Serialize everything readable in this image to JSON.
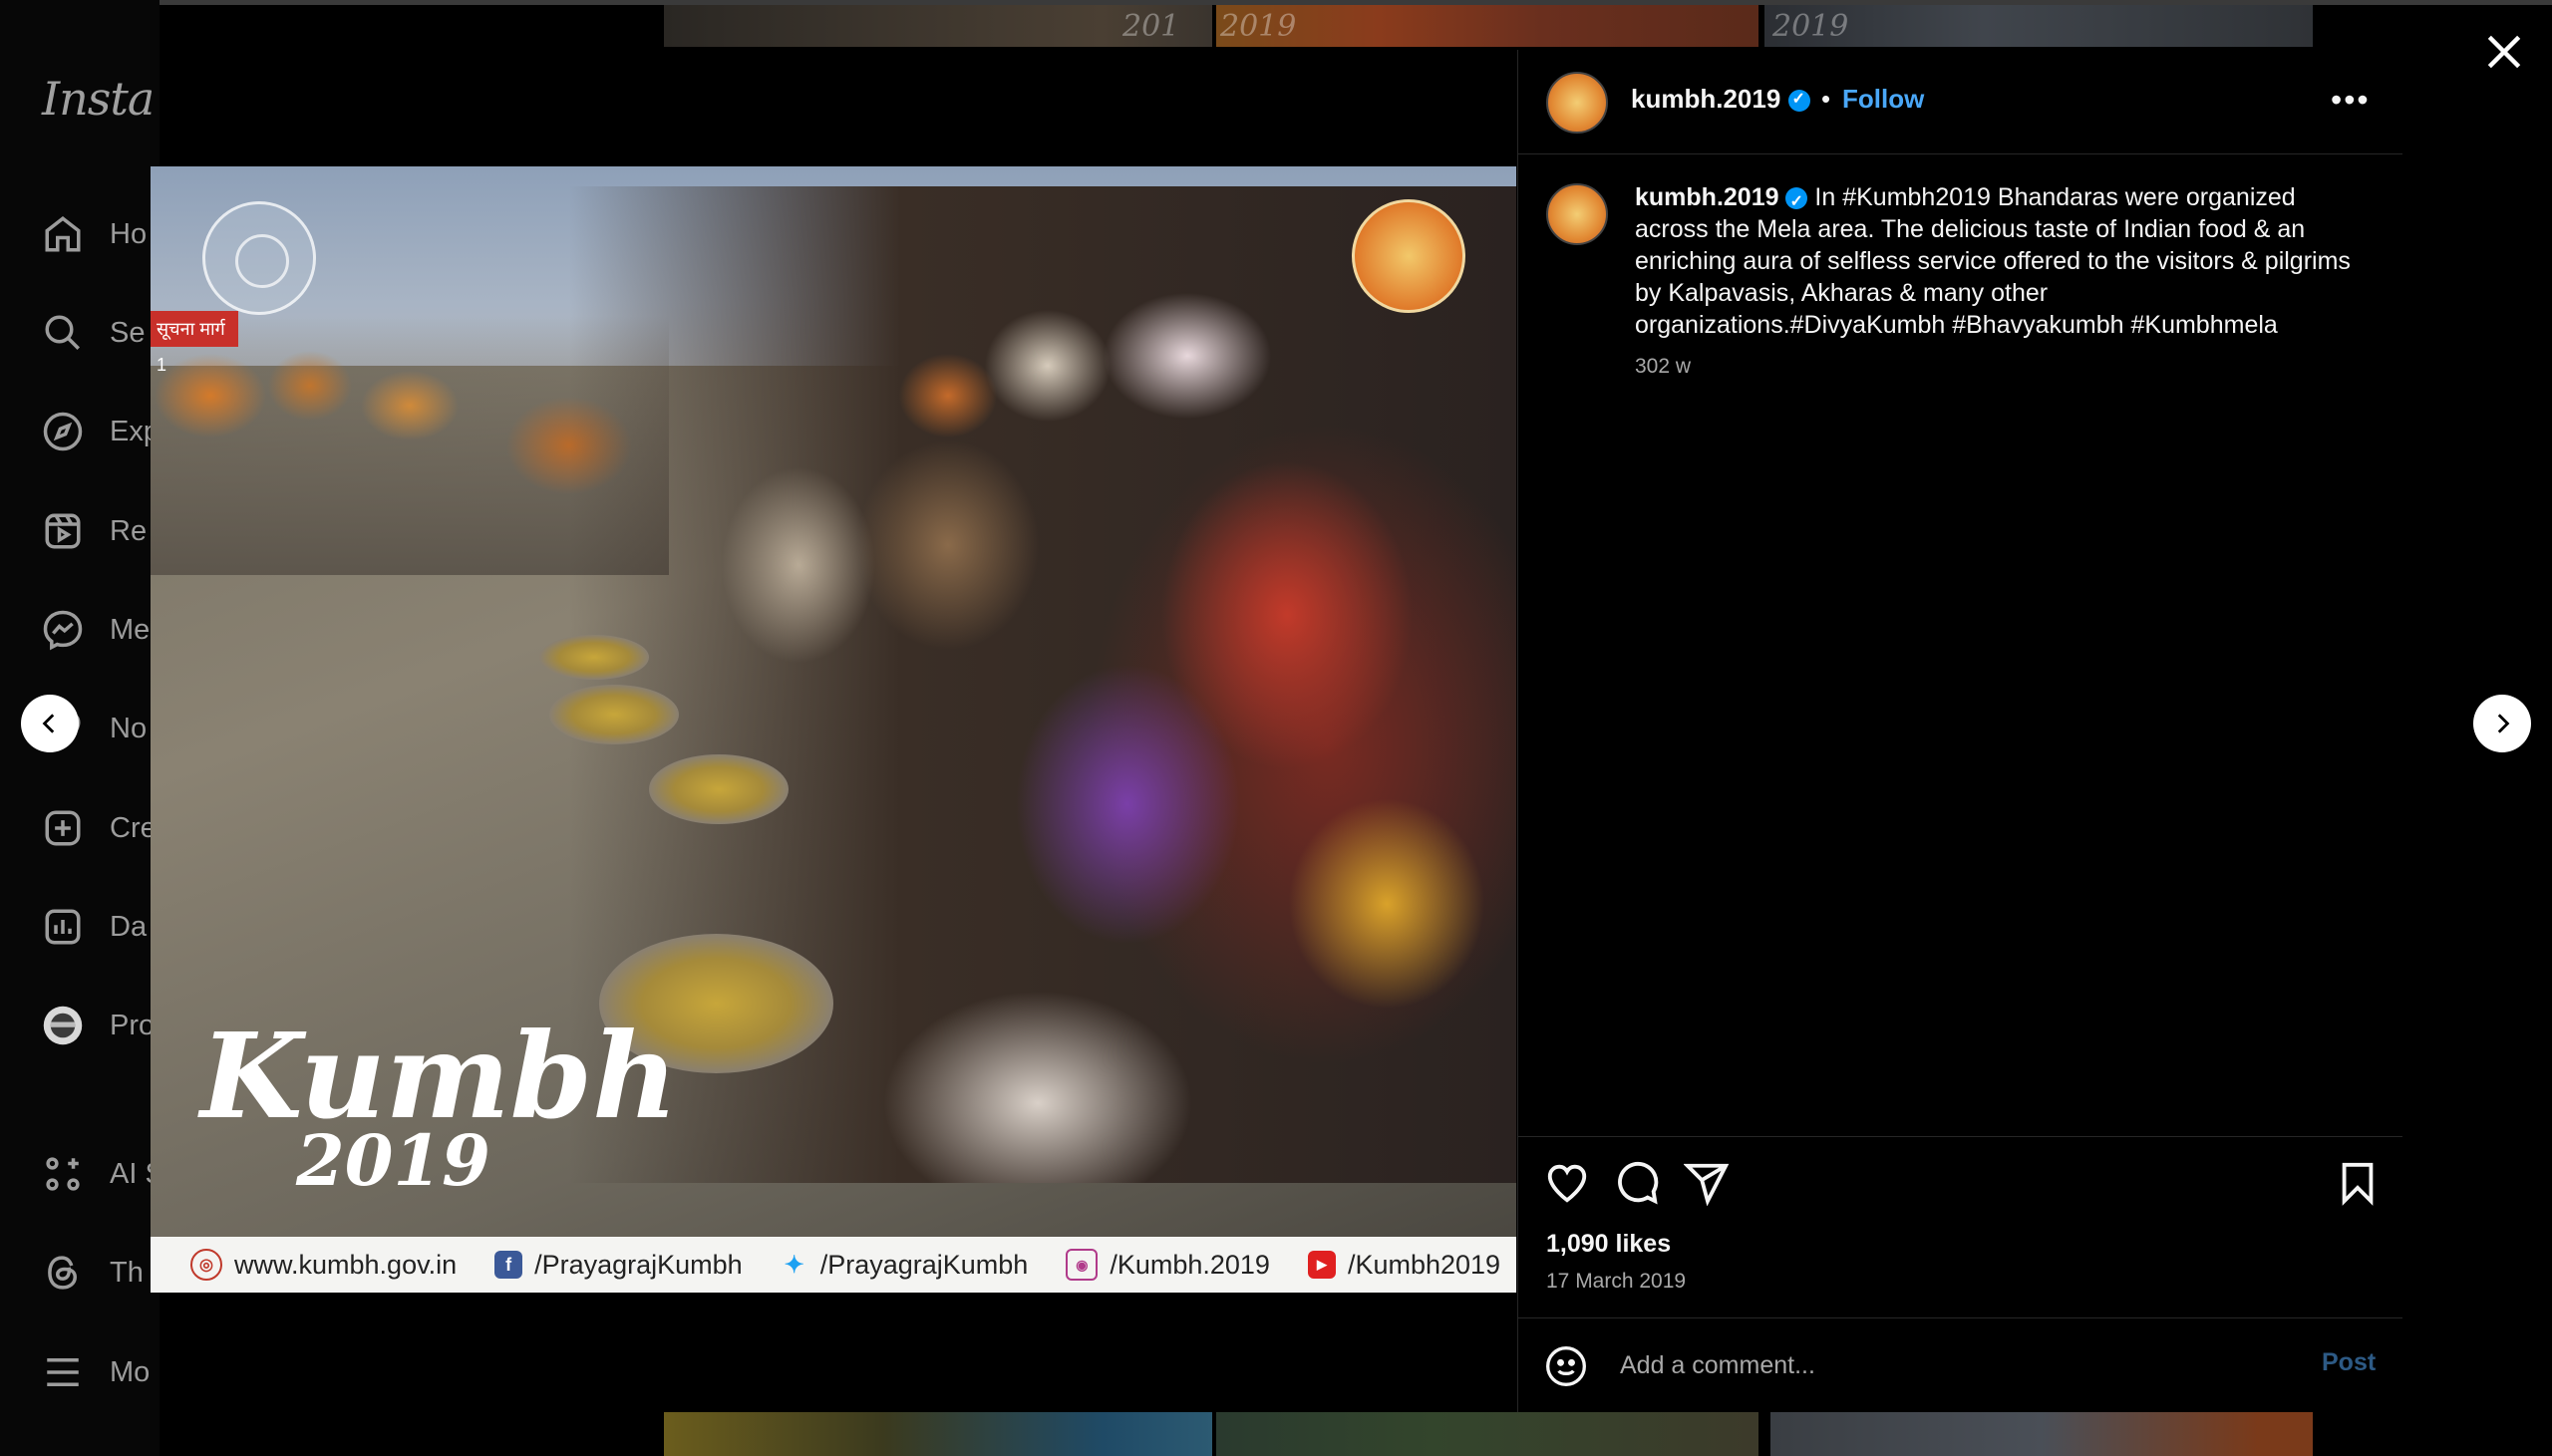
{
  "sidebar": {
    "logo": "Instag",
    "items": [
      {
        "label": "Ho",
        "icon": "home-icon"
      },
      {
        "label": "Se",
        "icon": "search-icon"
      },
      {
        "label": "Exp",
        "icon": "explore-icon"
      },
      {
        "label": "Re",
        "icon": "reels-icon"
      },
      {
        "label": "Me",
        "icon": "messenger-icon"
      },
      {
        "label": "No",
        "icon": "heart-icon"
      },
      {
        "label": "Cre",
        "icon": "create-icon"
      },
      {
        "label": "Da",
        "icon": "dashboard-icon"
      },
      {
        "label": "Pro",
        "icon": "profile-icon"
      },
      {
        "label": "AI S",
        "icon": "ai-studio-icon"
      },
      {
        "label": "Th",
        "icon": "threads-icon"
      },
      {
        "label": "Mo",
        "icon": "menu-icon"
      }
    ]
  },
  "post": {
    "username": "kumbh.2019",
    "follow_label": "Follow",
    "separator": "•",
    "more_label": "•••",
    "caption": "In #Kumbh2019 Bhandaras were organized across the Mela area. The delicious taste of Indian food & an enriching aura of selfless service offered to the visitors & pilgrims by Kalpavasis, Akharas & many other organizations.#DivyaKumbh #Bhavyakumbh #Kumbhmela",
    "relative_time": "302 w",
    "likes": "1,090 likes",
    "date": "17 March 2019",
    "comment_placeholder": "Add a comment...",
    "post_button": "Post"
  },
  "image": {
    "brand_line1": "Kumbh",
    "brand_line2": "2019",
    "sign_text": "सूचना मार्ग 1",
    "footer_links": [
      {
        "icon": "globe-icon",
        "text": "www.kumbh.gov.in"
      },
      {
        "icon": "facebook-icon",
        "text": "/PrayagrajKumbh"
      },
      {
        "icon": "twitter-icon",
        "text": "/PrayagrajKumbh"
      },
      {
        "icon": "instagram-icon",
        "text": "/Kumbh.2019"
      },
      {
        "icon": "youtube-icon",
        "text": "/Kumbh2019"
      }
    ]
  },
  "background_tags": {
    "t1": "201",
    "t2": "2019",
    "t3": "2019"
  },
  "colors": {
    "background": "#000000",
    "accent_blue": "#0095f6",
    "follow_blue": "#4aa7f7",
    "text": "#f5f5f5",
    "muted": "#a8a8a8"
  }
}
